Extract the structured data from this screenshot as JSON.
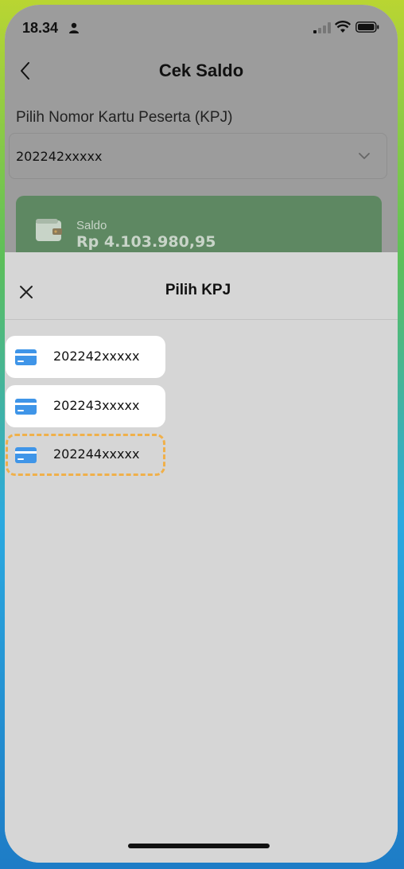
{
  "status_bar": {
    "time": "18.34",
    "icons": [
      "person-icon",
      "signal-icon",
      "wifi-icon",
      "battery-icon"
    ]
  },
  "header": {
    "back_icon": "chevron-left-icon",
    "title": "Cek Saldo"
  },
  "form": {
    "label": "Pilih Nomor Kartu Peserta (KPJ)",
    "selected_kpj": "202242xxxxx",
    "dropdown_icon": "chevron-down-icon"
  },
  "balance_card": {
    "icon": "wallet-icon",
    "label": "Saldo",
    "value": "Rp 4.103.980,95"
  },
  "sheet": {
    "close_icon": "close-icon",
    "title": "Pilih KPJ",
    "items": [
      {
        "number": "202242xxxxx",
        "icon": "card-icon",
        "selected": false
      },
      {
        "number": "202243xxxxx",
        "icon": "card-icon",
        "selected": false
      },
      {
        "number": "202244xxxxx",
        "icon": "card-icon",
        "selected": true
      }
    ]
  },
  "colors": {
    "card_blue": "#3f95e8",
    "selected_border": "#f0b04a",
    "balance_card": "#5e8862"
  }
}
